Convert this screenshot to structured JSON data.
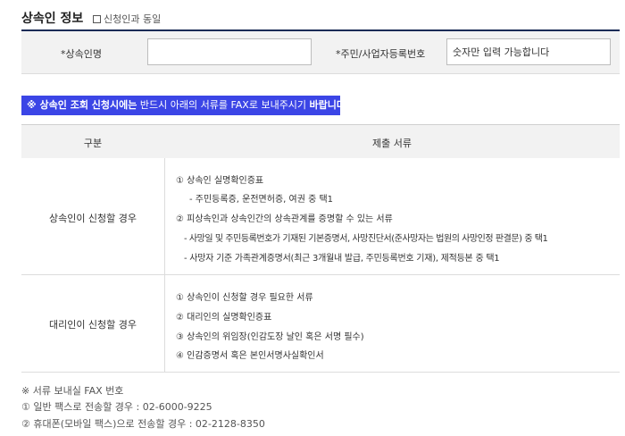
{
  "section": {
    "title": "상속인 정보",
    "same_as_applicant": "신청인과 동일"
  },
  "form": {
    "heir_name_label": "*상속인명",
    "heir_name_value": "",
    "id_label": "*주민/사업자등록번호",
    "id_placeholder": "숫자만 입력 가능합니다"
  },
  "notice": {
    "prefix": "※ 상속인 조회 신청시에는",
    "middle": " 반드시 아래의 서류를 FAX로 보내주시기 ",
    "suffix": "바랍니다."
  },
  "table": {
    "headers": [
      "구분",
      "제출 서류"
    ],
    "rows": [
      {
        "label": "상속인이 신청할 경우",
        "items": [
          "① 상속인 실명확인증표",
          "- 주민등록증, 운전면허증, 여권 중 택1",
          "② 피상속인과 상속인간의 상속관계를 증명할 수 있는 서류",
          "- 사망일 및 주민등록번호가 기재된 기본증명서, 사망진단서(준사망자는 법원의 사망인정 판결문) 중 택1",
          "- 사망자 기준 가족관계증명서(최근 3개월내 발급, 주민등록번호 기재), 제적등본 중 택1"
        ]
      },
      {
        "label": "대리인이 신청할 경우",
        "items": [
          "① 상속인이 신청할 경우 필요한 서류",
          "② 대리인의 실명확인증표",
          "③ 상속인의 위임장(인감도장 날인 혹은 서명 필수)",
          "④ 인감증명서 혹은 본인서명사실확인서"
        ]
      }
    ]
  },
  "footer": {
    "title": "※ 서류 보내실 FAX 번호",
    "line1": "① 일반 팩스로 전송할 경우 : 02-6000-9225",
    "line2": "② 휴대폰(모바일 팩스)으로 전송할 경우 : 02-2128-8350"
  },
  "colors": {
    "notice_bg": "#3b45e6",
    "title_rule": "#1a2b56"
  }
}
